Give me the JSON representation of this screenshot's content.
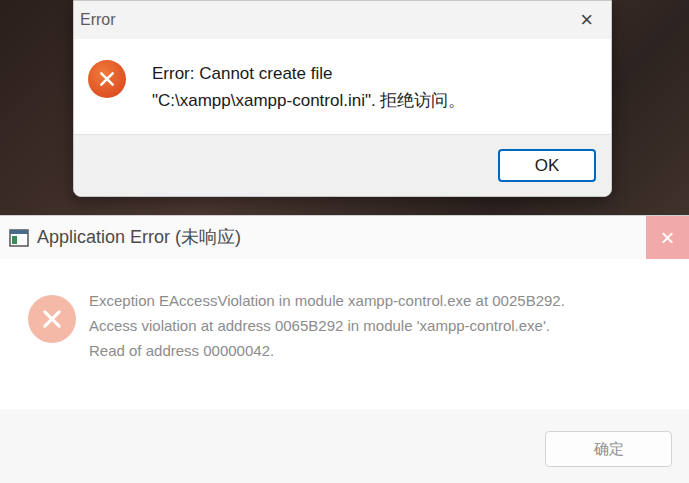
{
  "error_dialog": {
    "title": "Error",
    "close": "×",
    "message_lines": [
      "Error: Cannot create file",
      "\"C:\\xampp\\xampp-control.ini\". 拒绝访问。"
    ],
    "buttons": [
      {
        "label": "OK",
        "focused": true
      }
    ]
  },
  "app_error_dialog": {
    "title": "Application Error (未响应)",
    "close": "×",
    "not_responding": true,
    "message_lines": [
      "Exception EAccessViolation in module xampp-control.exe at 0025B292.",
      "Access violation at address 0065B292 in module 'xampp-control.exe'.",
      "Read of address 00000042."
    ],
    "buttons": [
      {
        "label": "确定",
        "focused": false
      }
    ]
  }
}
